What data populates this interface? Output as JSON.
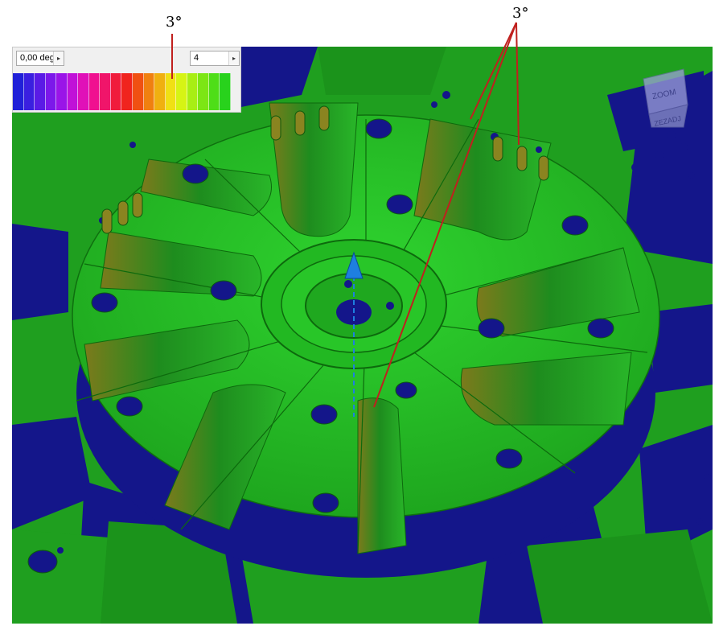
{
  "annotations": {
    "left_label": "3°",
    "right_label": "3°"
  },
  "draft_panel": {
    "angle_value": "0,00 deg",
    "steps_value": "4",
    "arrow_glyph": "▸",
    "palette": [
      "#2020d8",
      "#3a1fe0",
      "#5a1be6",
      "#7c18ea",
      "#9a14e8",
      "#c011d8",
      "#e010b8",
      "#f01090",
      "#f0156a",
      "#f01c3c",
      "#f0241e",
      "#f05012",
      "#f08010",
      "#f0b010",
      "#f0e014",
      "#d6f414",
      "#a8ee14",
      "#7ce614",
      "#4ede18",
      "#28d21c"
    ]
  },
  "viewcube": {
    "top_face": "ZOOM",
    "front_face": "ZEZADJ"
  },
  "colors": {
    "green": "#1f9f1f",
    "blue": "#14168a",
    "callout_line": "#c0201e",
    "axis": "#1e7fe0"
  }
}
